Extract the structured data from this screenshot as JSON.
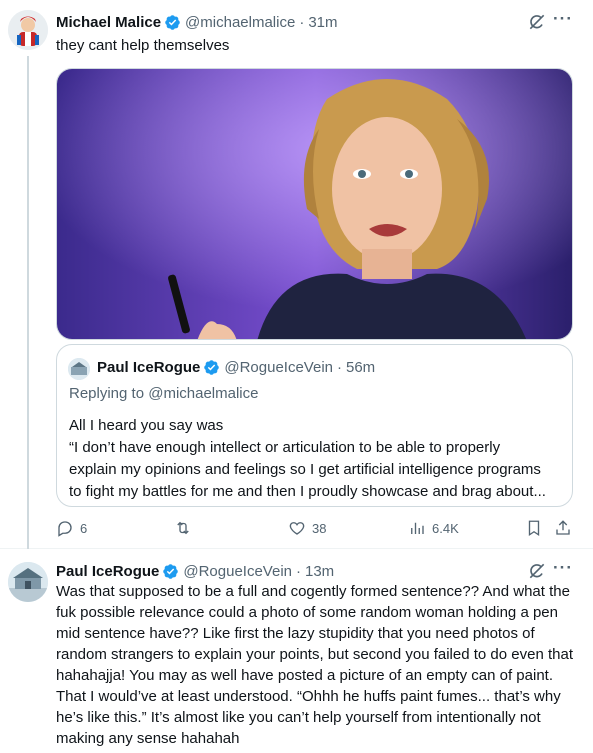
{
  "tweet1": {
    "author_name": "Michael Malice",
    "handle": "@michaelmalice",
    "separator": "·",
    "time": "31m",
    "text": "they cant help themselves",
    "media_alt_subject": "woman with blonde curly hair holding pen",
    "quote": {
      "author_name": "Paul IceRogue",
      "handle": "@RogueIceVein",
      "separator": "·",
      "time": "56m",
      "replying_prefix": "Replying to ",
      "replying_handle": "@michaelmalice",
      "line1": "All I heard you say was",
      "line2": "“I don’t have enough intellect or articulation to be able to properly",
      "line3": "explain my opinions and feelings so I get artificial intelligence programs",
      "line4": "to fight my battles for me and then I proudly showcase and brag about..."
    },
    "actions": {
      "replies": "6",
      "retweets": "",
      "likes": "38",
      "views": "6.4K"
    }
  },
  "tweet2": {
    "author_name": "Paul IceRogue",
    "handle": "@RogueIceVein",
    "separator": "·",
    "time": "13m",
    "text": "Was that supposed to be a full and cogently formed sentence?? And what the fuk possible relevance could a photo of some random woman holding a pen mid sentence have?? Like first the lazy stupidity that you need photos of random strangers to explain your points, but second you failed to do even that hahahajja! You may as well have posted a picture of an empty can of paint. That I would’ve at least understood. “Ohhh he huffs paint fumes... that’s why he’s like this.” It’s almost like you can’t help yourself from intentionally not making any sense hahahah"
  },
  "colors": {
    "text_primary": "#0f1419",
    "text_secondary": "#536471",
    "verified_blue": "#1d9bf0",
    "border": "#cfd9de"
  },
  "icons": [
    "verified-badge-icon",
    "grok-icon",
    "more-icon",
    "reply-icon",
    "retweet-icon",
    "like-icon",
    "views-icon",
    "bookmark-icon",
    "share-icon"
  ]
}
